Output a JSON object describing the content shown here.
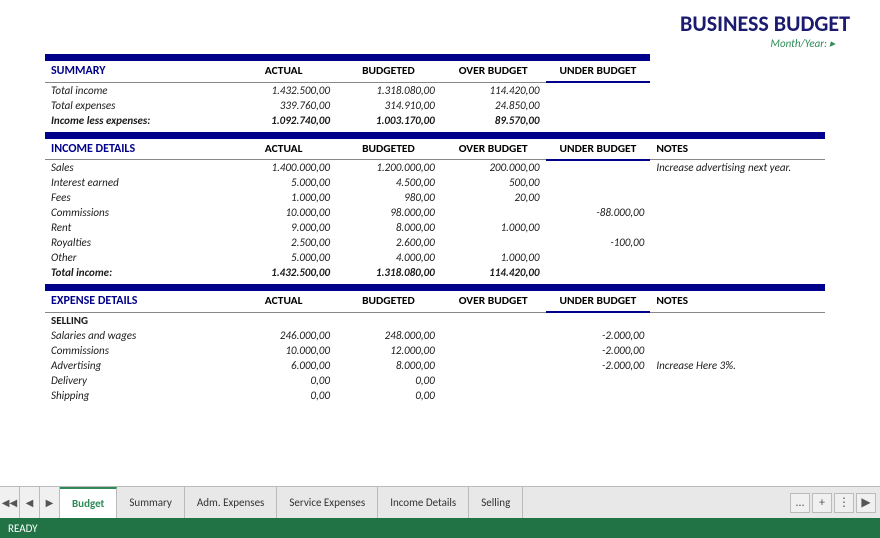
{
  "title": "BUSINESS BUDGET",
  "month_year_label": "Month/Year:",
  "status": "READY",
  "summary": {
    "section_label": "SUMMARY",
    "col_actual": "ACTUAL",
    "col_budgeted": "BUDGETED",
    "col_over": "OVER BUDGET",
    "col_under": "UNDER BUDGET",
    "rows": [
      {
        "label": "Total income",
        "actual": "1.432.500,00",
        "budgeted": "1.318.080,00",
        "over": "114.420,00",
        "under": ""
      },
      {
        "label": "Total expenses",
        "actual": "339.760,00",
        "budgeted": "314.910,00",
        "over": "24.850,00",
        "under": ""
      },
      {
        "label": "Income less expenses:",
        "actual": "1.092.740,00",
        "budgeted": "1.003.170,00",
        "over": "89.570,00",
        "under": "",
        "bold": true
      }
    ]
  },
  "income_details": {
    "section_label": "INCOME DETAILS",
    "col_actual": "ACTUAL",
    "col_budgeted": "BUDGETED",
    "col_over": "OVER BUDGET",
    "col_under": "UNDER BUDGET",
    "col_notes": "NOTES",
    "rows": [
      {
        "label": "Sales",
        "actual": "1.400.000,00",
        "budgeted": "1.200.000,00",
        "over": "200.000,00",
        "under": "",
        "notes": "Increase advertising next year."
      },
      {
        "label": "Interest earned",
        "actual": "5.000,00",
        "budgeted": "4.500,00",
        "over": "500,00",
        "under": "",
        "notes": ""
      },
      {
        "label": "Fees",
        "actual": "1.000,00",
        "budgeted": "980,00",
        "over": "20,00",
        "under": "",
        "notes": ""
      },
      {
        "label": "Commissions",
        "actual": "10.000,00",
        "budgeted": "98.000,00",
        "over": "",
        "under": "-88.000,00",
        "notes": ""
      },
      {
        "label": "Rent",
        "actual": "9.000,00",
        "budgeted": "8.000,00",
        "over": "1.000,00",
        "under": "",
        "notes": ""
      },
      {
        "label": "Royalties",
        "actual": "2.500,00",
        "budgeted": "2.600,00",
        "over": "",
        "under": "-100,00",
        "notes": ""
      },
      {
        "label": "Other",
        "actual": "5.000,00",
        "budgeted": "4.000,00",
        "over": "1.000,00",
        "under": "",
        "notes": ""
      },
      {
        "label": "Total income:",
        "actual": "1.432.500,00",
        "budgeted": "1.318.080,00",
        "over": "114.420,00",
        "under": "",
        "notes": "",
        "bold": true
      }
    ]
  },
  "expense_details": {
    "section_label": "EXPENSE DETAILS",
    "col_actual": "ACTUAL",
    "col_budgeted": "BUDGETED",
    "col_over": "OVER BUDGET",
    "col_under": "UNDER BUDGET",
    "col_notes": "NOTES",
    "selling_label": "SELLING",
    "rows": [
      {
        "label": "Salaries and wages",
        "actual": "246.000,00",
        "budgeted": "248.000,00",
        "over": "",
        "under": "-2.000,00",
        "notes": ""
      },
      {
        "label": "Commissions",
        "actual": "10.000,00",
        "budgeted": "12.000,00",
        "over": "",
        "under": "-2.000,00",
        "notes": ""
      },
      {
        "label": "Advertising",
        "actual": "6.000,00",
        "budgeted": "8.000,00",
        "over": "",
        "under": "-2.000,00",
        "notes": "Increase Here 3%."
      },
      {
        "label": "Delivery",
        "actual": "0,00",
        "budgeted": "0,00",
        "over": "",
        "under": "",
        "notes": ""
      },
      {
        "label": "Shipping",
        "actual": "0,00",
        "budgeted": "0,00",
        "over": "",
        "under": "",
        "notes": ""
      }
    ]
  },
  "tabs": [
    {
      "label": "Budget",
      "active": true
    },
    {
      "label": "Summary",
      "active": false
    },
    {
      "label": "Adm. Expenses",
      "active": false
    },
    {
      "label": "Service Expenses",
      "active": false
    },
    {
      "label": "Income Details",
      "active": false
    },
    {
      "label": "Selling",
      "active": false
    }
  ]
}
